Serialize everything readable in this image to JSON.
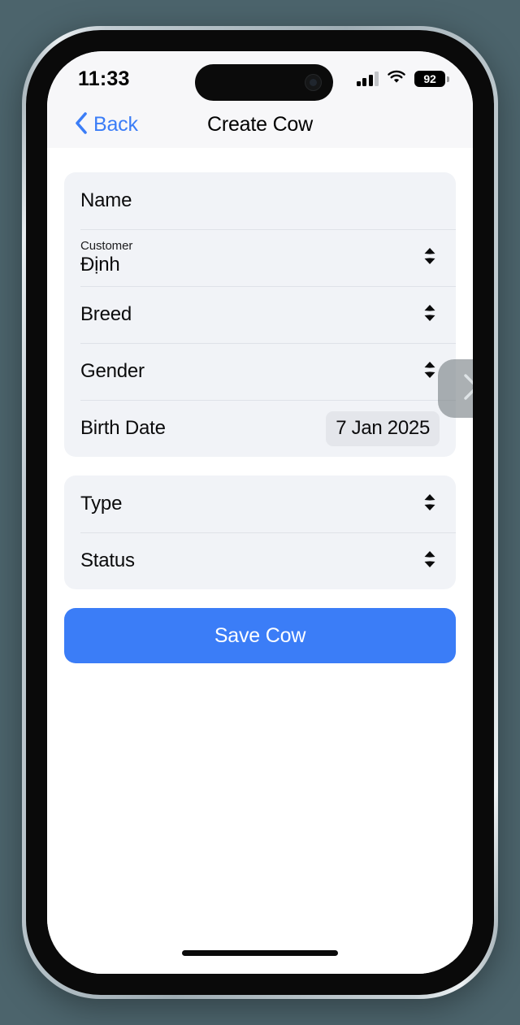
{
  "status_bar": {
    "time": "11:33",
    "signal_icon": "cellular-signal-icon",
    "wifi_icon": "wifi-icon",
    "battery_level": "92",
    "battery_icon": "battery-icon"
  },
  "nav_bar": {
    "back_label": "Back",
    "back_icon": "chevron-left-icon",
    "title": "Create Cow"
  },
  "form": {
    "sections": [
      {
        "rows": [
          {
            "label": "Name",
            "type": "text-input",
            "value": "",
            "icon": ""
          },
          {
            "label": "Customer",
            "type": "picker",
            "value": "Định",
            "icon": "chevron-up-down-icon"
          },
          {
            "label": "Breed",
            "type": "picker",
            "value": "",
            "icon": "chevron-up-down-icon"
          },
          {
            "label": "Gender",
            "type": "picker",
            "value": "",
            "icon": "chevron-up-down-icon"
          },
          {
            "label": "Birth Date",
            "type": "date",
            "value": "7 Jan 2025",
            "icon": ""
          }
        ]
      },
      {
        "rows": [
          {
            "label": "Type",
            "type": "picker",
            "value": "",
            "icon": "chevron-up-down-icon"
          },
          {
            "label": "Status",
            "type": "picker",
            "value": "",
            "icon": "chevron-up-down-icon"
          }
        ]
      }
    ],
    "save_button_label": "Save Cow"
  },
  "overlay": {
    "forward_icon": "chevron-right-icon"
  },
  "colors": {
    "accent_blue": "#3b7df7",
    "card_background": "#f1f3f7",
    "screen_background": "#ffffff",
    "nav_background": "#f7f7f9",
    "date_pill": "#e4e6eb",
    "page_background": "#4c646c"
  }
}
